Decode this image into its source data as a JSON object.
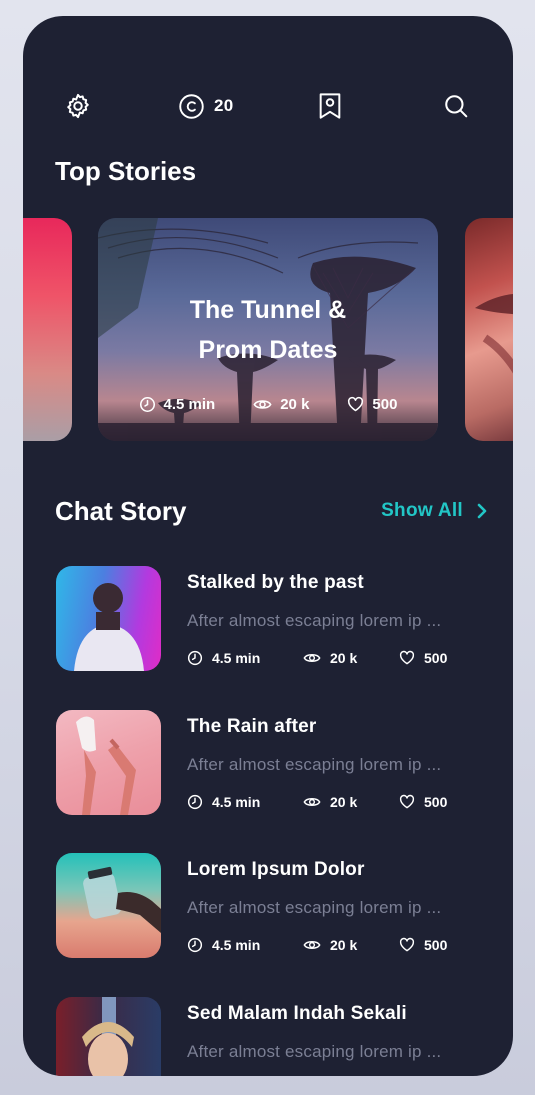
{
  "header": {
    "coins": "20",
    "icons": [
      "gear-icon",
      "coin-icon",
      "bookmark-icon",
      "search-icon"
    ]
  },
  "top_stories": {
    "title": "Top Stories",
    "featured": {
      "title_line1": "The Tunnel &",
      "title_line2": "Prom Dates",
      "duration": "4.5 min",
      "views": "20 k",
      "likes": "500"
    }
  },
  "chat_story": {
    "title": "Chat Story",
    "show_all": "Show All",
    "items": [
      {
        "title": "Stalked by the past",
        "desc": "After almost escaping lorem ip ...",
        "duration": "4.5 min",
        "views": "20 k",
        "likes": "500"
      },
      {
        "title": "The Rain after",
        "desc": "After almost escaping lorem ip ...",
        "duration": "4.5 min",
        "views": "20 k",
        "likes": "500"
      },
      {
        "title": "Lorem Ipsum Dolor",
        "desc": "After almost escaping lorem ip ...",
        "duration": "4.5 min",
        "views": "20 k",
        "likes": "500"
      },
      {
        "title": "Sed Malam Indah Sekali",
        "desc": "After almost escaping lorem ip ..."
      }
    ]
  },
  "colors": {
    "background": "#1e2133",
    "accent": "#22c6c6",
    "muted_text": "#7b7f94"
  }
}
